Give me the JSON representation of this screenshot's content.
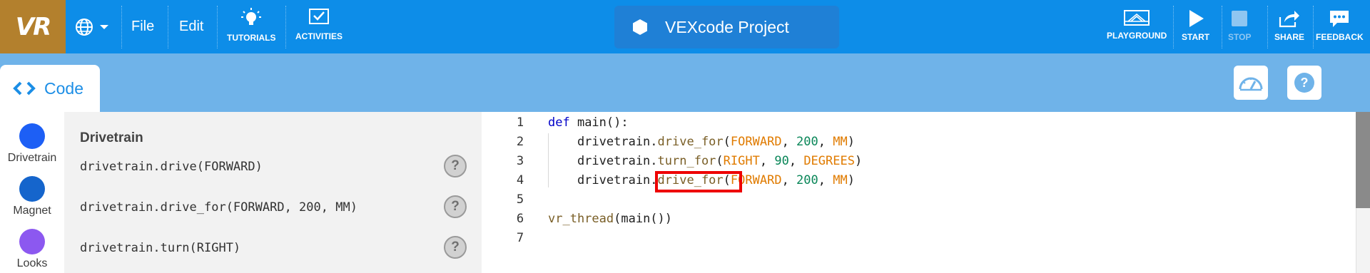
{
  "topbar": {
    "logo": "VR",
    "menu": {
      "file": "File",
      "edit": "Edit"
    },
    "tools": {
      "tutorials": "TUTORIALS",
      "activities": "ACTIVITIES"
    },
    "project_title": "VEXcode Project",
    "right_tools": {
      "playground": "PLAYGROUND",
      "start": "START",
      "stop": "STOP",
      "share": "SHARE",
      "feedback": "FEEDBACK"
    }
  },
  "subbar": {
    "code_tab": "Code"
  },
  "categories": [
    {
      "label": "Drivetrain",
      "color": "#1d5ff5"
    },
    {
      "label": "Magnet",
      "color": "#1565cc"
    },
    {
      "label": "Looks",
      "color": "#8c58f0"
    }
  ],
  "palette": {
    "title": "Drivetrain",
    "blocks": [
      "drivetrain.drive(FORWARD)",
      "drivetrain.drive_for(FORWARD, 200, MM)",
      "drivetrain.turn(RIGHT)"
    ],
    "help_symbol": "?"
  },
  "editor": {
    "line_numbers": [
      "1",
      "2",
      "3",
      "4",
      "5",
      "6",
      "7"
    ],
    "lines": [
      "def main():",
      "    drivetrain.drive_for(FORWARD, 200, MM)",
      "    drivetrain.turn_for(RIGHT, 90, DEGREES)",
      "    drivetrain.drive_for(FORWARD, 200, MM)",
      "",
      "vr_thread(main())",
      ""
    ],
    "highlighted_token": "drive_for"
  },
  "colors": {
    "topbar": "#0d8de8",
    "logo_bg": "#b3802d",
    "subbar": "#6fb3e9",
    "highlight": "#ee0000"
  }
}
